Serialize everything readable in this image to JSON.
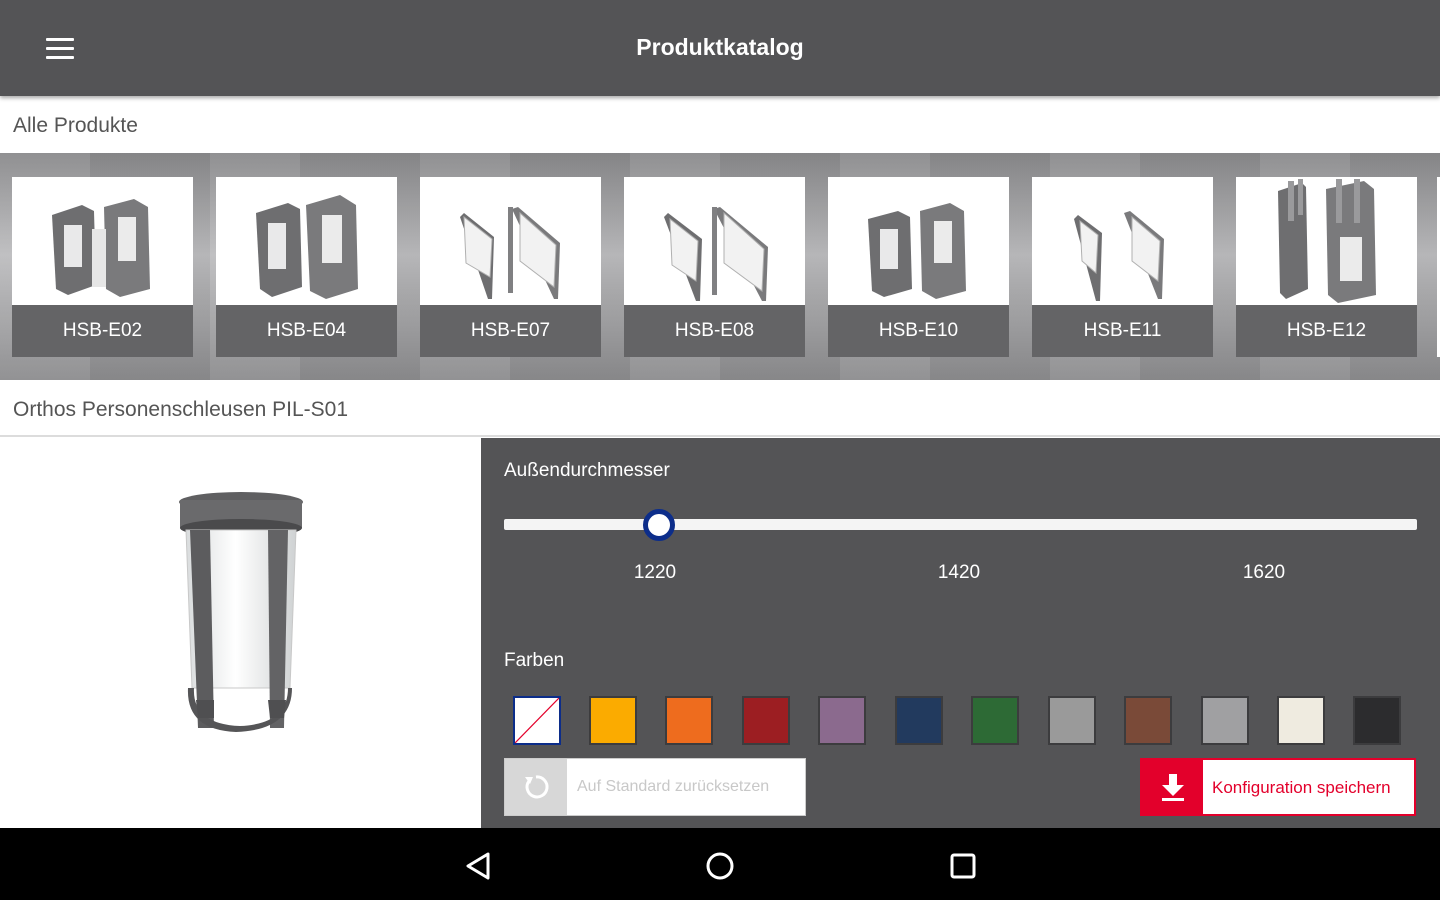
{
  "app_bar": {
    "title": "Produktkatalog",
    "menu_icon": "hamburger-menu-icon"
  },
  "all_products": {
    "header": "Alle Produkte",
    "items": [
      {
        "label": "HSB-E02"
      },
      {
        "label": "HSB-E04"
      },
      {
        "label": "HSB-E07"
      },
      {
        "label": "HSB-E08"
      },
      {
        "label": "HSB-E10"
      },
      {
        "label": "HSB-E11"
      },
      {
        "label": "HSB-E12"
      }
    ]
  },
  "selected_product": {
    "header": "Orthos Personenschleusen PIL-S01"
  },
  "config": {
    "diameter_label": "Außendurchmesser",
    "diameter_value": 1220,
    "diameter_ticks": [
      "1220",
      "1420",
      "1620"
    ],
    "colors_label": "Farben",
    "colors": [
      "none",
      "#FBAB00",
      "#EE6C1E",
      "#9C1E22",
      "#8B6A8E",
      "#223A5E",
      "#2D6A35",
      "#9A9A9A",
      "#7A4A38",
      "#A0A0A2",
      "#EFEBE0",
      "#2C2C2E"
    ],
    "selected_color_index": 0,
    "reset_label": "Auf Standard zurücksetzen",
    "save_label": "Konfiguration speichern",
    "accent_color": "#E3002B",
    "slider_color": "#0C2D8A"
  },
  "system_nav": {
    "back": "back-triangle-icon",
    "home": "home-circle-icon",
    "recents": "recents-square-icon"
  }
}
